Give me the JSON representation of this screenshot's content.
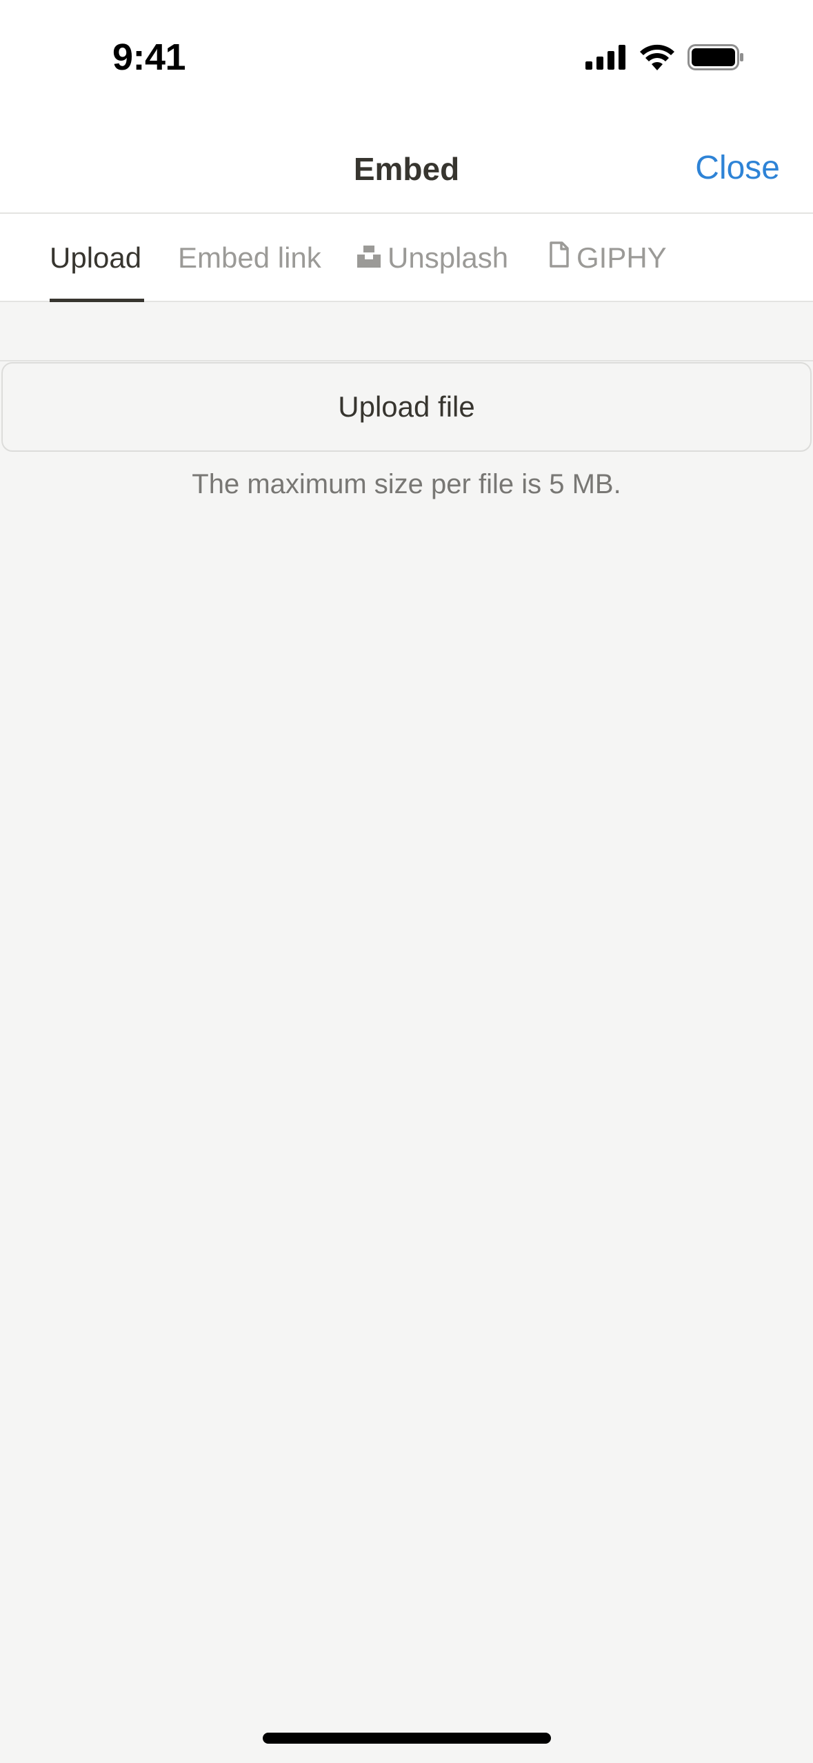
{
  "status_bar": {
    "time": "9:41",
    "icons": [
      "cellular-signal-icon",
      "wifi-icon",
      "battery-icon"
    ]
  },
  "header": {
    "title": "Embed",
    "close_label": "Close",
    "accent_color": "#2e83d6"
  },
  "tabs": [
    {
      "label": "Upload",
      "active": true
    },
    {
      "label": "Embed link",
      "active": false
    },
    {
      "label": "Unsplash",
      "active": false,
      "icon": "unsplash-icon"
    },
    {
      "label": "GIPHY",
      "active": false,
      "icon": "document-icon"
    }
  ],
  "content": {
    "upload_button_label": "Upload file",
    "max_size_note": "The maximum size per file is 5 MB."
  }
}
